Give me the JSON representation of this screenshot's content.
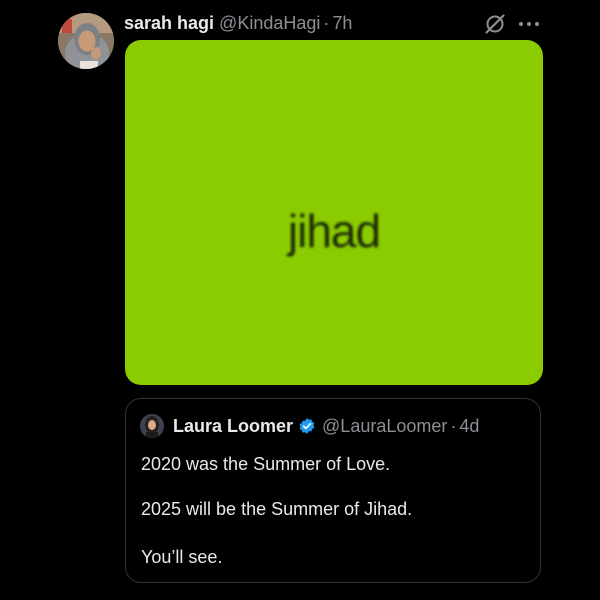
{
  "tweet": {
    "author": {
      "display_name": "sarah hagi",
      "handle": "@KindaHagi",
      "separator": "·",
      "time": "7h",
      "avatar_icon": "user-avatar"
    },
    "actions": {
      "grok_icon": "grok-icon",
      "more_icon": "more-horizontal-icon"
    },
    "media": {
      "background": "#8acc00",
      "text": "jihad"
    },
    "quote": {
      "author": {
        "display_name": "Laura Loomer",
        "verified_icon": "verified-badge-icon",
        "verified_color": "#1d9bf0",
        "handle": "@LauraLoomer",
        "separator": "·",
        "time": "4d",
        "avatar_icon": "user-avatar"
      },
      "lines": [
        "2020 was the Summer of Love.",
        "2025 will be the Summer of Jihad.",
        "You’ll see."
      ]
    }
  }
}
